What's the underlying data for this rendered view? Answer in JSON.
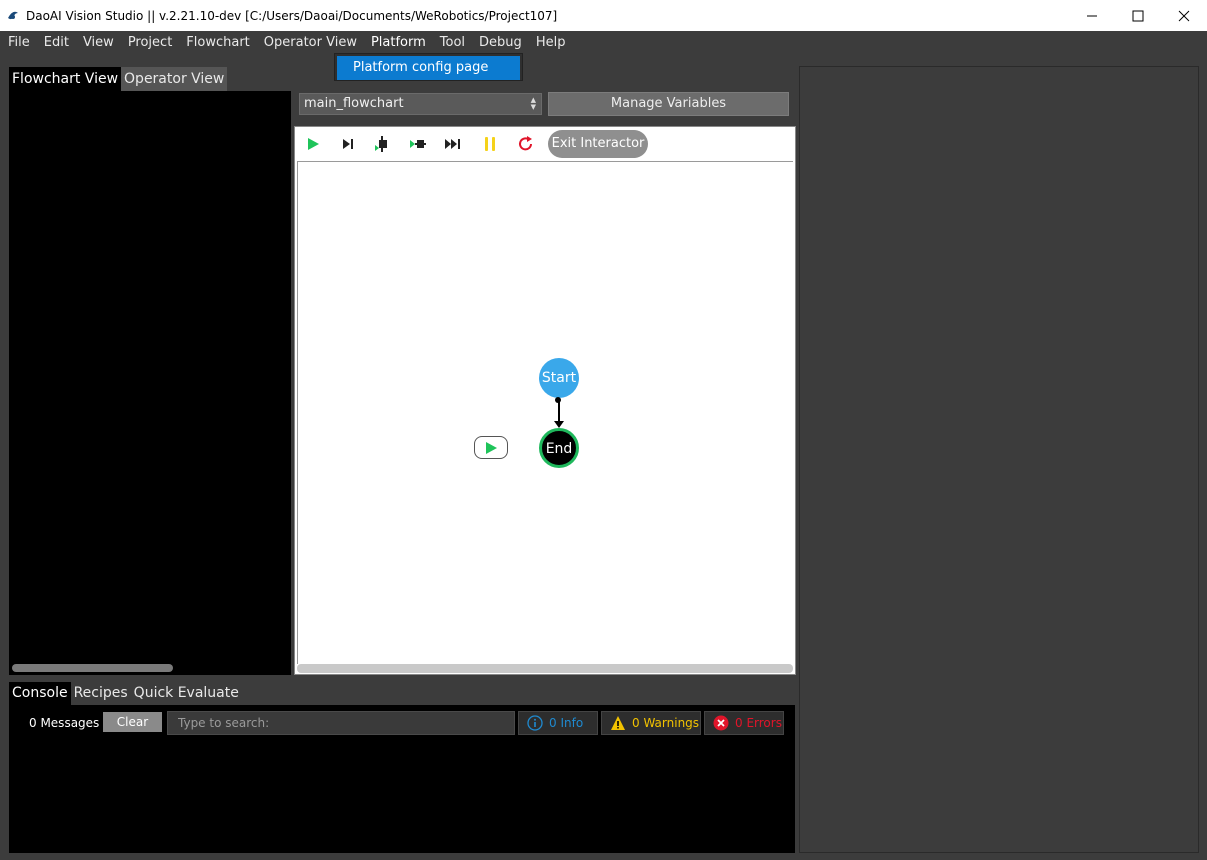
{
  "window": {
    "title": "DaoAI Vision Studio || v.2.21.10-dev   [C:/Users/Daoai/Documents/WeRobotics/Project107]",
    "controls": {
      "minimize": "—",
      "maximize": "☐",
      "close": "✕"
    }
  },
  "menubar": {
    "items": [
      "File",
      "Edit",
      "View",
      "Project",
      "Flowchart",
      "Operator View",
      "Platform",
      "Tool",
      "Debug",
      "Help"
    ]
  },
  "platform_menu": {
    "items": [
      "Platform config page"
    ]
  },
  "left_tabs": [
    "Flowchart View",
    "Operator View"
  ],
  "flowchart": {
    "selected": "main_flowchart",
    "manage_variables": "Manage Variables",
    "exit_interactor": "Exit Interactor",
    "toolbar_icons": [
      "run-icon",
      "step-icon",
      "step-into-icon",
      "step-over-icon",
      "fast-forward-icon",
      "pause-icon",
      "restart-icon"
    ],
    "nodes": {
      "start": "Start",
      "end": "End"
    }
  },
  "console": {
    "tabs": [
      "Console",
      "Recipes",
      "Quick Evaluate"
    ],
    "message_count": "0 Messages",
    "clear": "Clear",
    "search_placeholder": "Type to search:",
    "info": "0 Info",
    "warnings": "0 Warnings",
    "errors": "0 Errors"
  },
  "colors": {
    "menu_highlight": "#0c7bd0",
    "start_node": "#3aa8ea",
    "end_node_ring": "#1fb85c",
    "run_green": "#1fc45a",
    "pause_yellow": "#f5d21a",
    "restart_red": "#e0152a",
    "info_blue": "#1f8ad0",
    "warning_yellow": "#f2c200",
    "error_red": "#e0152a"
  }
}
